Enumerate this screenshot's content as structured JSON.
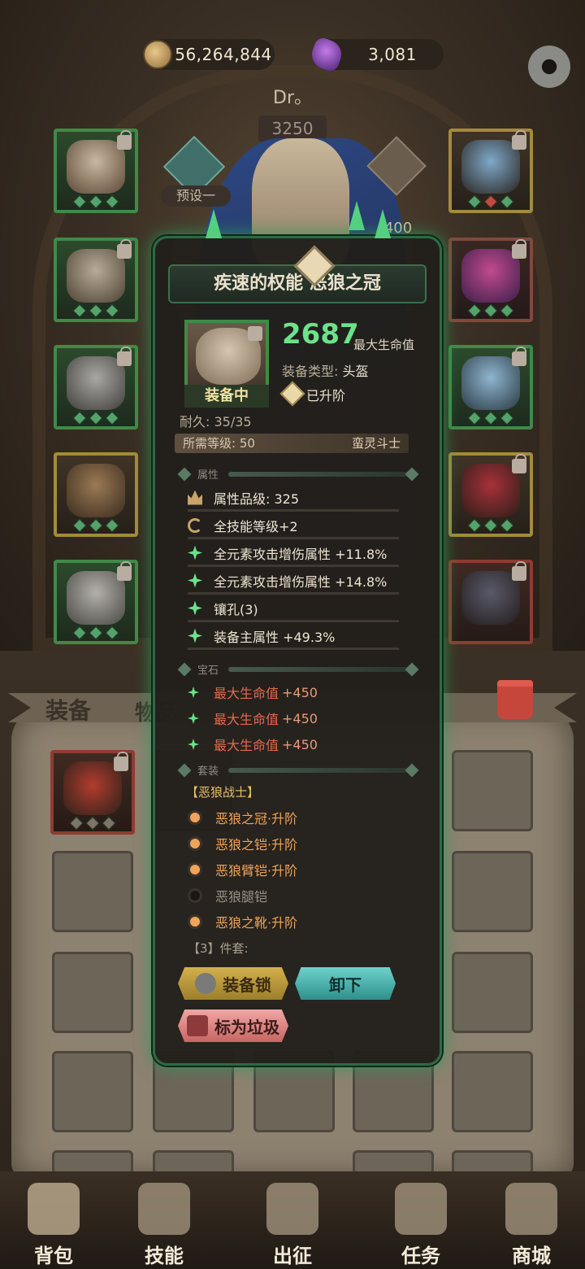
{
  "top_bar": {
    "coins": "56,264,844",
    "gems": "3,081",
    "coin_icon": "coin-icon",
    "gem_icon": "purple-crystal-icon",
    "settings_icon": "gear-icon"
  },
  "hero": {
    "name": "Dr。",
    "level": "3250",
    "preset_label": "预设一",
    "power": "400"
  },
  "tooltip": {
    "title": "疾速的权能 恶狼之冠",
    "equipped_label": "装备中",
    "main_stat_value": "2687",
    "main_stat_name": "最大生命值",
    "type_label": "装备类型:",
    "type_value": "头盔",
    "upgraded_label": "已升阶",
    "durability": "耐久: 35/35",
    "required_level_label": "所需等级: 50",
    "required_class": "蛮灵斗士",
    "section_attributes": "属性",
    "attributes": [
      {
        "icon": "crown-icon",
        "text": "属性品级: 325"
      },
      {
        "icon": "cycle-icon",
        "text": "全技能等级+2"
      },
      {
        "icon": "spark-icon",
        "text": "全元素攻击增伤属性 +11.8%"
      },
      {
        "icon": "spark-icon",
        "text": "全元素攻击增伤属性 +14.8%"
      },
      {
        "icon": "spark-icon",
        "text": "镶孔(3)"
      },
      {
        "icon": "spark-icon",
        "text": "装备主属性 +49.3%"
      }
    ],
    "section_gems": "宝石",
    "gems": [
      {
        "name": "最大生命值",
        "value": "+450"
      },
      {
        "name": "最大生命值",
        "value": "+450"
      },
      {
        "name": "最大生命值",
        "value": "+450"
      }
    ],
    "section_set": "套装",
    "set_name": "【恶狼战士】",
    "set_items": [
      {
        "name": "恶狼之冠·升阶",
        "active": true
      },
      {
        "name": "恶狼之铠·升阶",
        "active": true
      },
      {
        "name": "恶狼臂铠·升阶",
        "active": true
      },
      {
        "name": "恶狼腿铠",
        "active": false
      },
      {
        "name": "恶狼之靴·升阶",
        "active": true
      }
    ],
    "set_count": "【3】件套:",
    "btn_lock": "装备锁",
    "btn_unequip": "卸下",
    "btn_junk": "标为垃圾"
  },
  "bag": {
    "tab_equipment": "装备",
    "tab_items": "物品",
    "trash_icon": "trash-can-icon"
  },
  "nav": [
    {
      "label": "背包",
      "icon": "backpack-icon"
    },
    {
      "label": "技能",
      "icon": "skill-book-icon"
    },
    {
      "label": "出征",
      "icon": "sword-icon"
    },
    {
      "label": "任务",
      "icon": "scroll-icon"
    },
    {
      "label": "商城",
      "icon": "shop-icon"
    }
  ],
  "colors": {
    "accent_green": "#6be38a",
    "gem_red": "#e26a4f",
    "set_orange": "#f0a45a"
  }
}
